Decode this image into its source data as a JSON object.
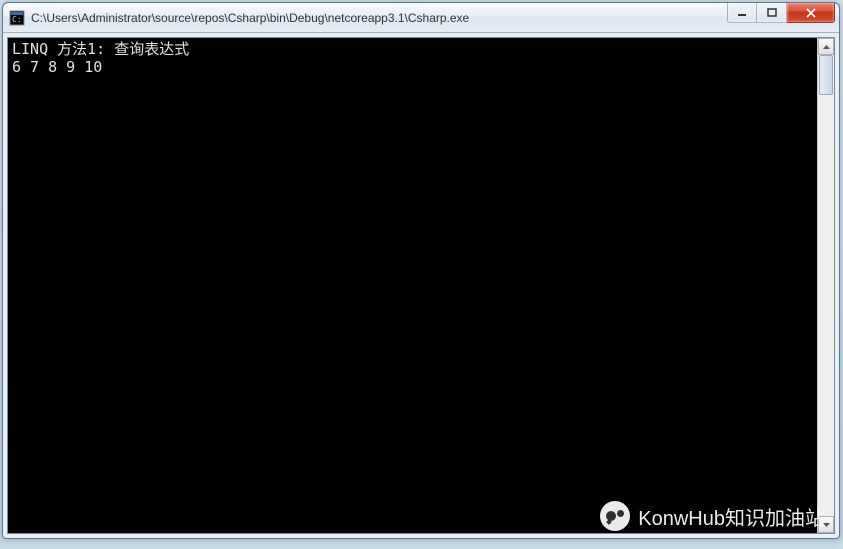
{
  "window": {
    "title": "C:\\Users\\Administrator\\source\\repos\\Csharp\\bin\\Debug\\netcoreapp3.1\\Csharp.exe"
  },
  "console": {
    "lines": [
      "LINQ 方法1: 查询表达式",
      "6 7 8 9 10"
    ]
  },
  "watermark": {
    "text": "KonwHub知识加油站"
  }
}
